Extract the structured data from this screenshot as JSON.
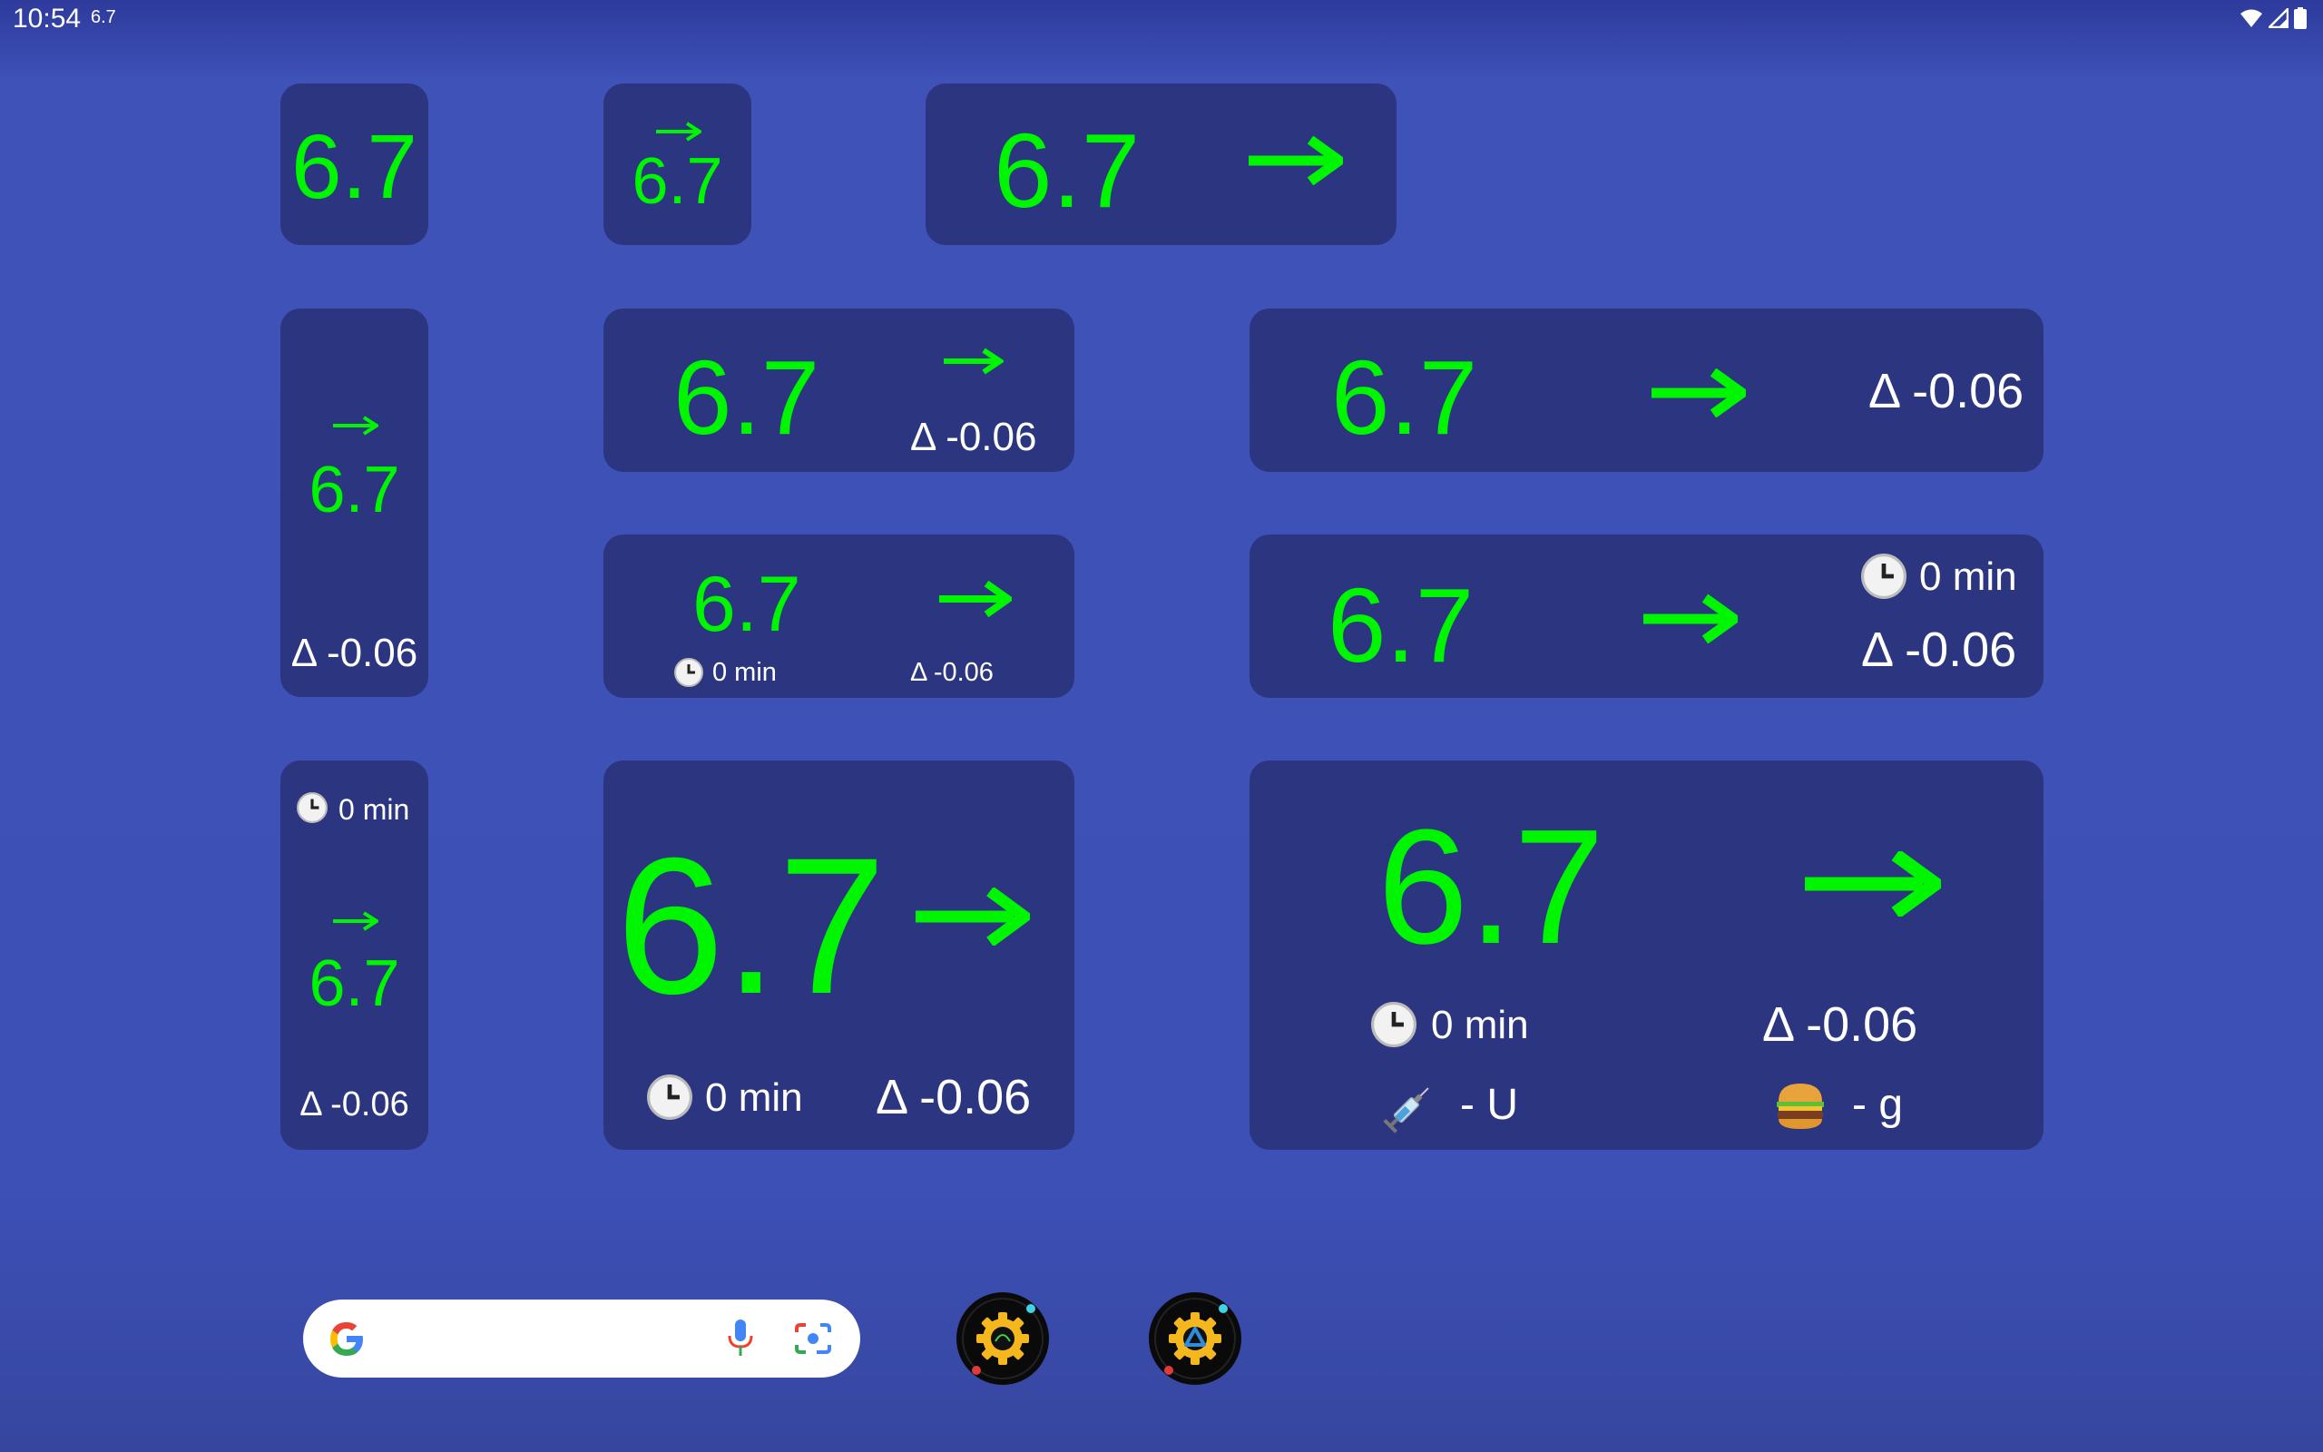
{
  "status_bar": {
    "time": "10:54",
    "notification_value": "6.7"
  },
  "reading": {
    "value": "6.7",
    "delta": "Δ -0.06",
    "minutes": "0 min",
    "insulin": "- U",
    "carbs": "- g"
  },
  "colors": {
    "value": "#00f500",
    "widget_bg": "#2c3680",
    "text": "#ffffff"
  },
  "icons": {
    "trend": "right-arrow-icon",
    "clock": "clock-icon",
    "syringe": "syringe-icon",
    "burger": "burger-icon"
  }
}
